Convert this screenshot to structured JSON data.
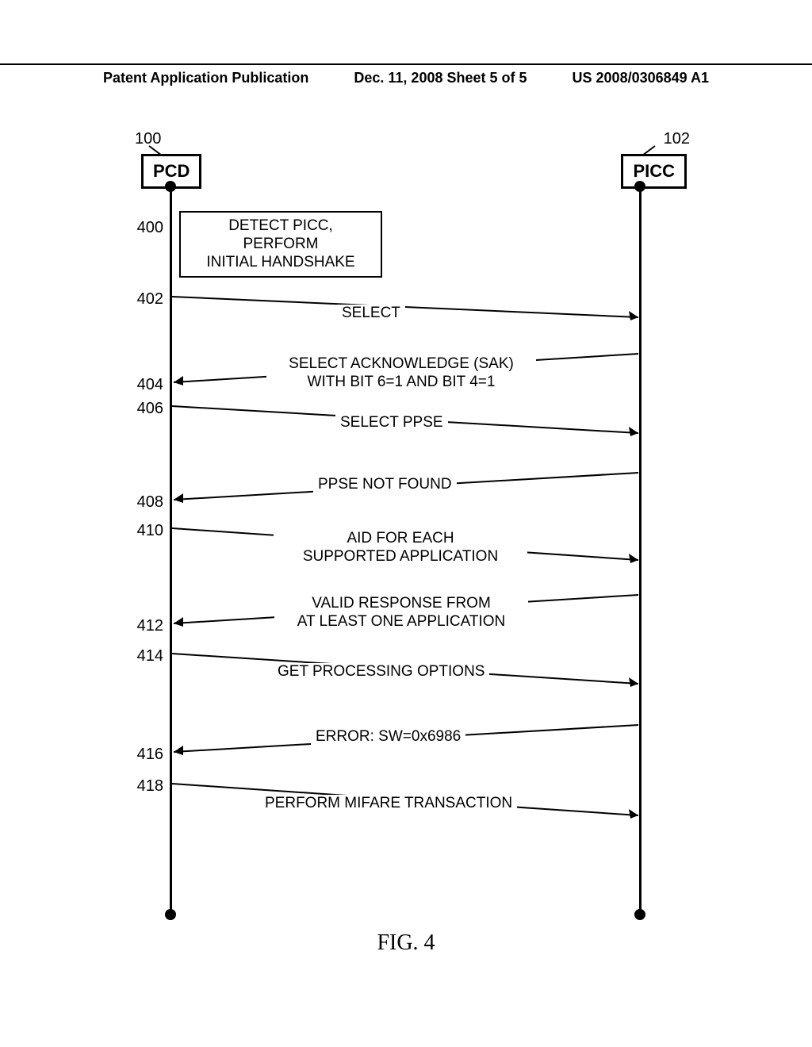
{
  "header": {
    "left": "Patent Application Publication",
    "center": "Dec. 11, 2008  Sheet 5 of 5",
    "right": "US 2008/0306849 A1"
  },
  "participants": {
    "pcd": {
      "label": "PCD",
      "ref": "100"
    },
    "picc": {
      "label": "PICC",
      "ref": "102"
    }
  },
  "steps": {
    "s400": {
      "ref": "400",
      "text_line1": "DETECT PICC, PERFORM",
      "text_line2": "INITIAL HANDSHAKE"
    },
    "s402": {
      "ref": "402",
      "text": "SELECT"
    },
    "s404": {
      "ref": "404",
      "text_line1": "SELECT ACKNOWLEDGE (SAK)",
      "text_line2": "WITH BIT 6=1 AND BIT 4=1"
    },
    "s406": {
      "ref": "406",
      "text": "SELECT PPSE"
    },
    "s408": {
      "ref": "408",
      "text": "PPSE NOT FOUND"
    },
    "s410": {
      "ref": "410",
      "text_line1": "AID FOR EACH",
      "text_line2": "SUPPORTED APPLICATION"
    },
    "s412": {
      "ref": "412",
      "text_line1": "VALID RESPONSE FROM",
      "text_line2": "AT LEAST ONE APPLICATION"
    },
    "s414": {
      "ref": "414",
      "text": "GET PROCESSING OPTIONS"
    },
    "s416": {
      "ref": "416",
      "text": "ERROR: SW=0x6986"
    },
    "s418": {
      "ref": "418",
      "text": "PERFORM MIFARE TRANSACTION"
    }
  },
  "figure_caption": "FIG. 4"
}
